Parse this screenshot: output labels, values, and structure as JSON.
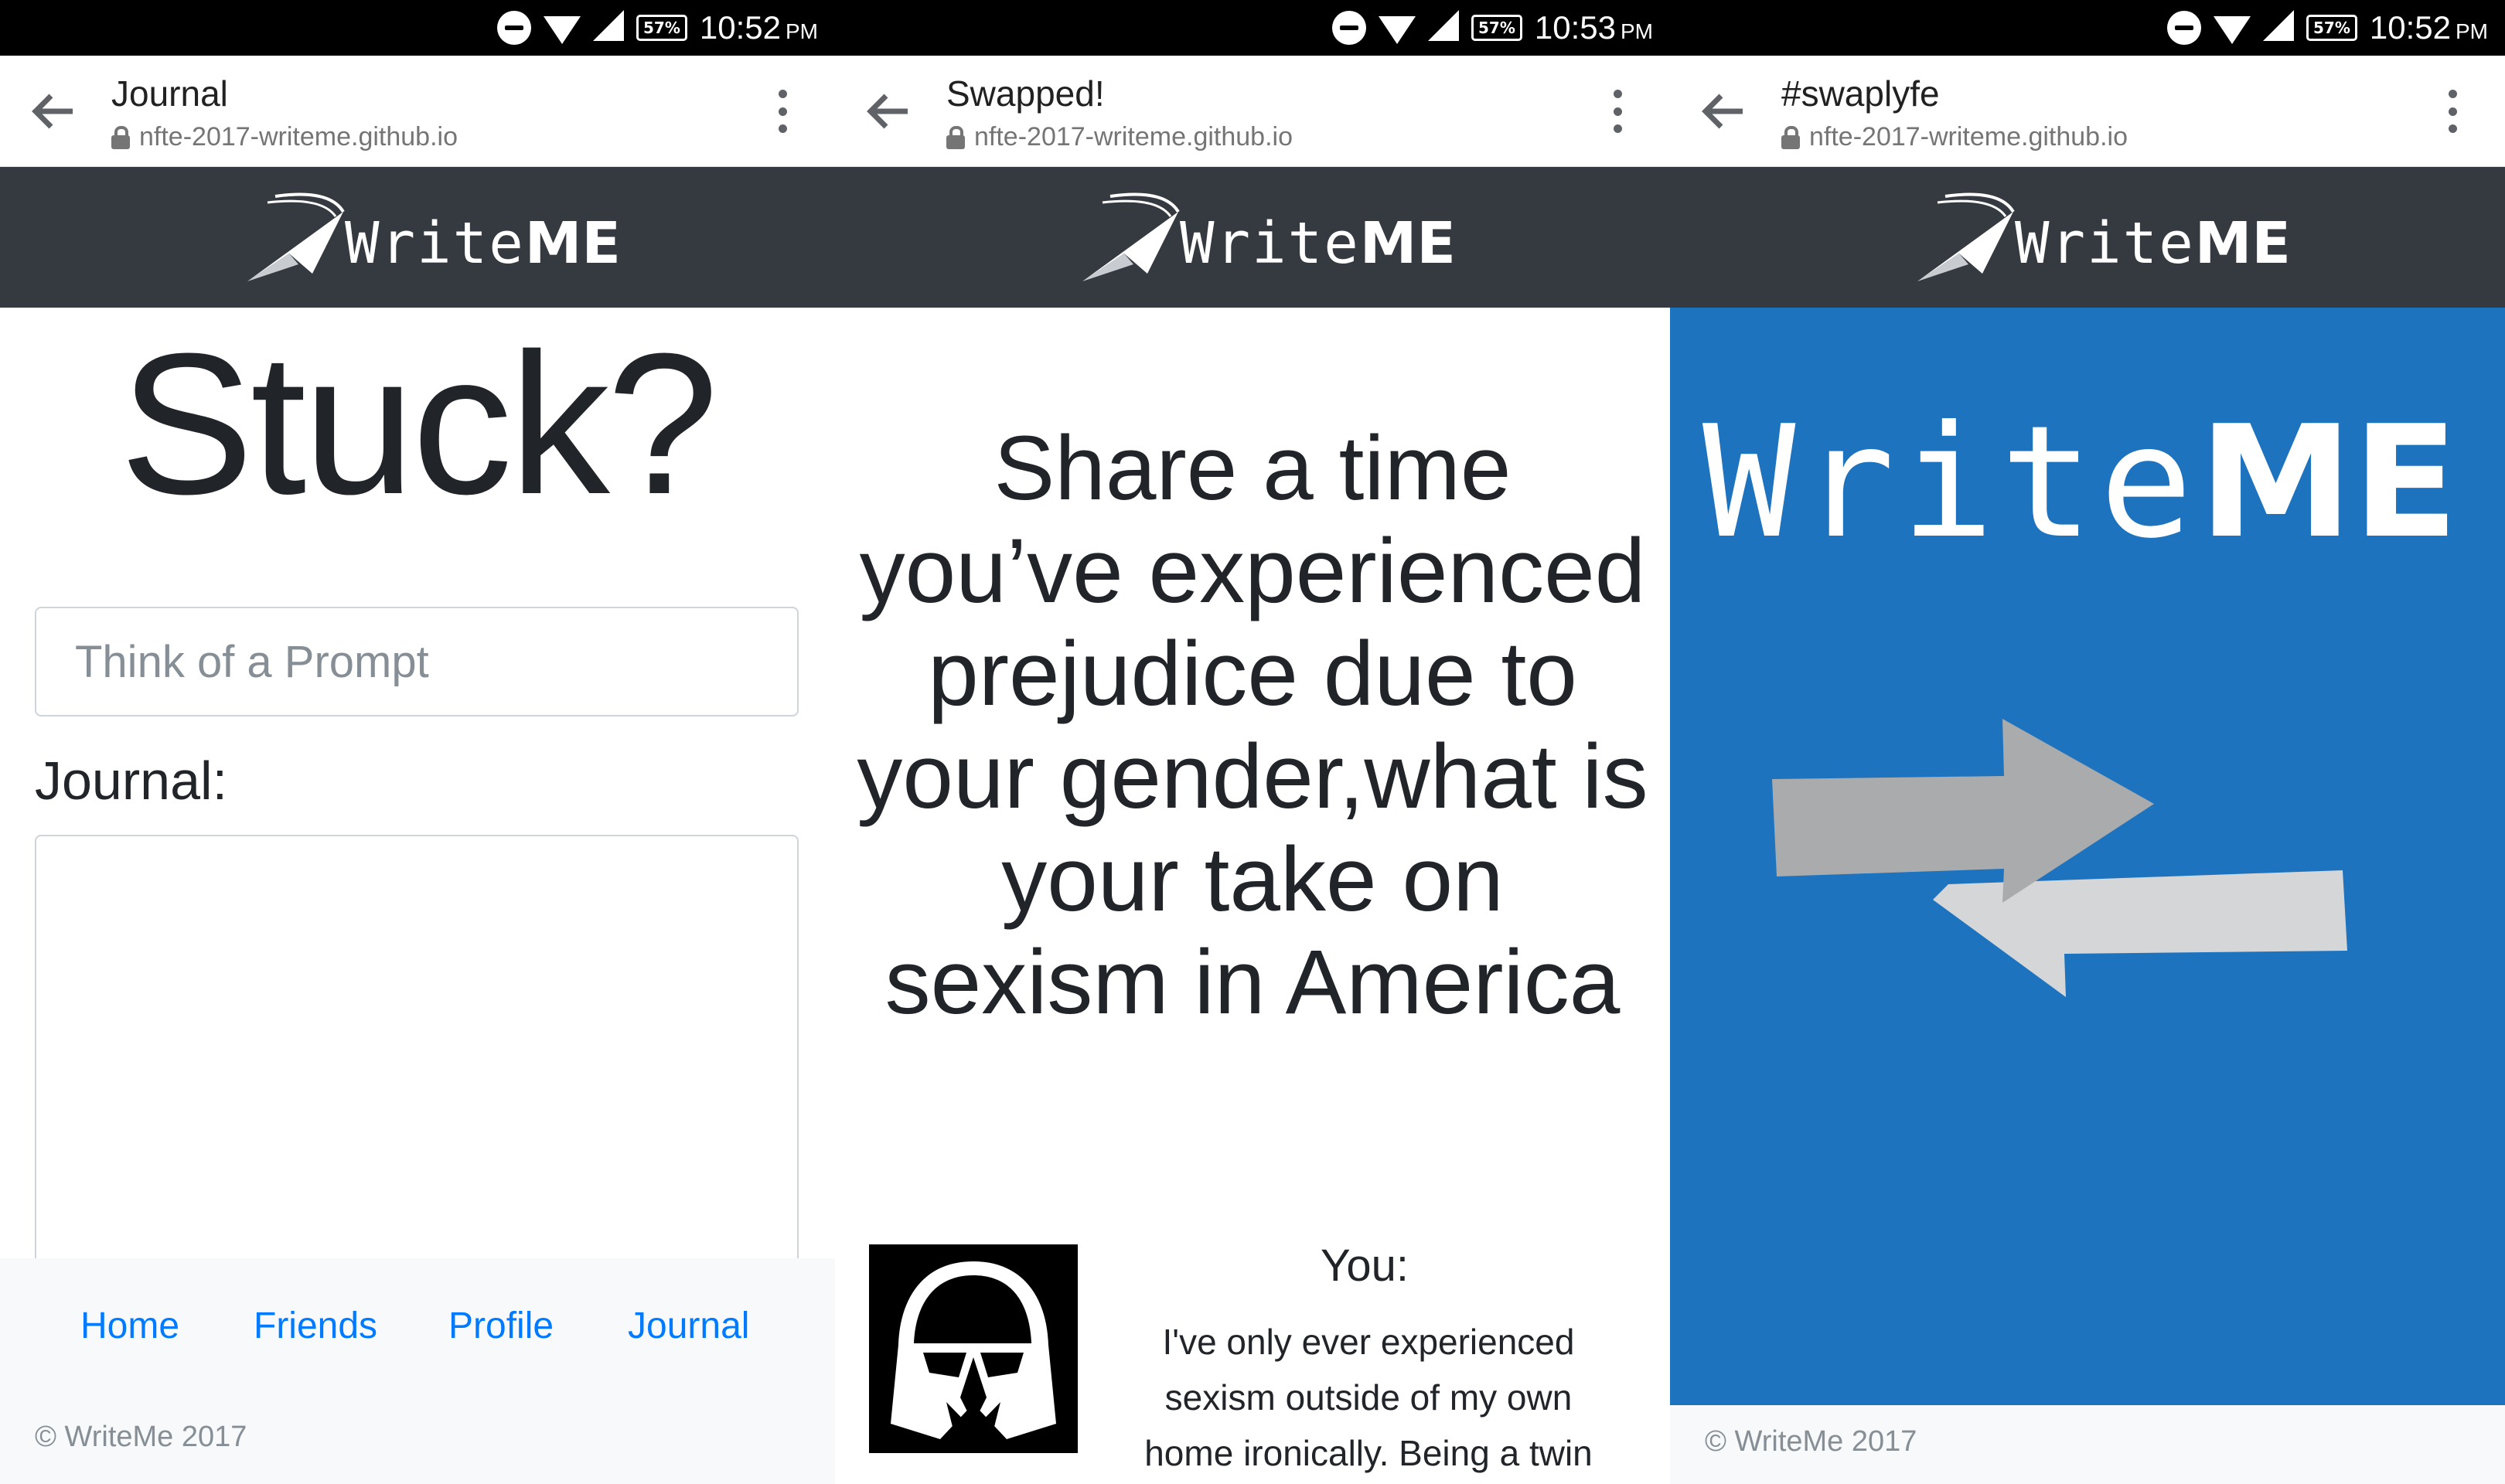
{
  "screens": [
    {
      "status": {
        "battery": "57%",
        "time": "10:52",
        "ampm": "PM"
      },
      "tab_title": "Journal",
      "url": "nfte-2017-writeme.github.io",
      "logo": {
        "light": "Write",
        "bold": "ME"
      },
      "heading": "Stuck?",
      "prompt_placeholder": "Think of a Prompt",
      "journal_label": "Journal:",
      "nav": [
        "Home",
        "Friends",
        "Profile",
        "Journal"
      ],
      "copyright": "© WriteMe 2017"
    },
    {
      "status": {
        "battery": "57%",
        "time": "10:53",
        "ampm": "PM"
      },
      "tab_title": "Swapped!",
      "url": "nfte-2017-writeme.github.io",
      "logo": {
        "light": "Write",
        "bold": "ME"
      },
      "question": "Share a time you’ve experienced prejudice due to your gender,what is your take on sexism in America",
      "you_label": "You:",
      "response": "I've only ever experienced sexism outside of my own home ironically. Being a twin"
    },
    {
      "status": {
        "battery": "57%",
        "time": "10:52",
        "ampm": "PM"
      },
      "tab_title": "#swaplyfe",
      "url": "nfte-2017-writeme.github.io",
      "logo": {
        "light": "Write",
        "bold": "ME"
      },
      "hero_logo": {
        "light": "Write",
        "bold": "ME"
      },
      "copyright": "© WriteMe 2017"
    }
  ],
  "colors": {
    "navbar": "#343a40",
    "hero": "#1e73be",
    "link": "#007bff",
    "footer": "#f8f9fa"
  }
}
